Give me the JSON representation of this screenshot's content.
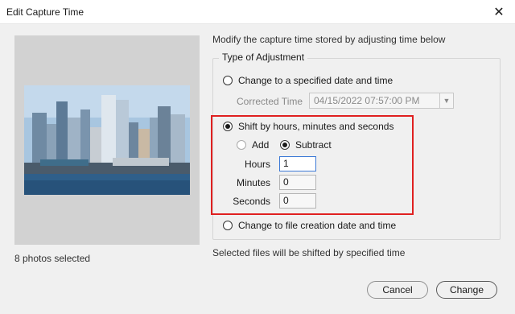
{
  "window": {
    "title": "Edit Capture Time",
    "close_glyph": "✕"
  },
  "preview": {
    "photos_selected": "8 photos selected"
  },
  "instruction": "Modify the capture time stored by adjusting time below",
  "group": {
    "legend": "Type of Adjustment",
    "options": {
      "specified": "Change to a specified date and time",
      "shift": "Shift by hours, minutes and seconds",
      "file_creation": "Change to file creation date and time"
    },
    "selected": "shift",
    "corrected_time_label": "Corrected Time",
    "corrected_time_value": "04/15/2022  07:57:00 PM",
    "direction": {
      "add": "Add",
      "subtract": "Subtract",
      "selected": "subtract"
    },
    "fields": {
      "hours": {
        "label": "Hours",
        "value": "1"
      },
      "minutes": {
        "label": "Minutes",
        "value": "0"
      },
      "seconds": {
        "label": "Seconds",
        "value": "0"
      }
    }
  },
  "footer_note": "Selected files will be shifted by specified time",
  "buttons": {
    "cancel": "Cancel",
    "change": "Change"
  },
  "colors": {
    "highlight": "#e02020",
    "focus": "#3d7ad6"
  }
}
